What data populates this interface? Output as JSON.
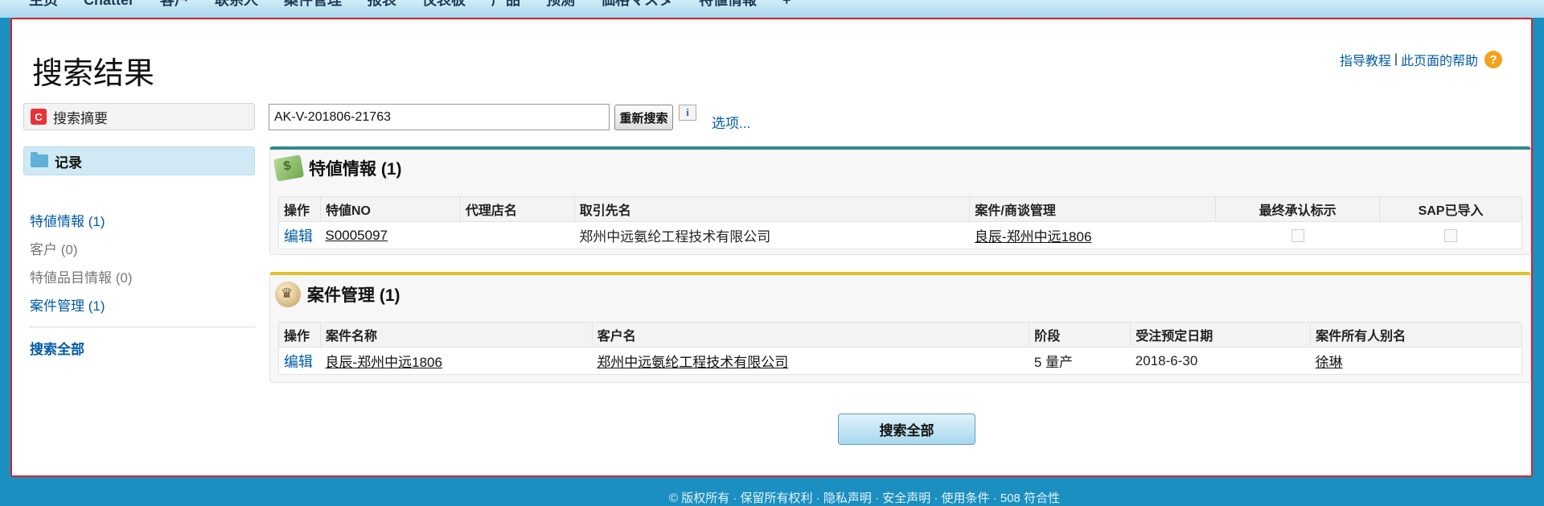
{
  "tabs": [
    "主页",
    "Chatter",
    "客户",
    "联系人",
    "案件管理",
    "报表",
    "仪表板",
    "产品",
    "预测",
    "価格マスタ",
    "特値情報",
    "+"
  ],
  "page": {
    "title": "搜索结果",
    "help_tutorial": "指导教程",
    "help_separator": "|",
    "help_page": "此页面的帮助",
    "help_icon": "?"
  },
  "sidebar": {
    "summary_label": "搜索摘要",
    "summary_icon": "C",
    "records_label": "记录",
    "items": [
      {
        "label": "特値情報",
        "count": "(1)"
      },
      {
        "label": "客户",
        "count": "(0)"
      },
      {
        "label": "特値品目情報",
        "count": "(0)"
      },
      {
        "label": "案件管理",
        "count": "(1)"
      }
    ],
    "search_all": "搜索全部"
  },
  "search": {
    "value": "AK-V-201806-21763",
    "button": "重新搜索",
    "info": "i",
    "options": "选项..."
  },
  "deal_section": {
    "title": "特値情報 (1)",
    "headers": [
      "操作",
      "特値NO",
      "代理店名",
      "取引先名",
      "案件/商谈管理",
      "最终承认标示",
      "SAP已导入"
    ],
    "row": {
      "action": "编辑",
      "no": "S0005097",
      "agent": "",
      "client": "郑州中远氨纶工程技术有限公司",
      "case": "良辰-郑州中远1806"
    }
  },
  "case_section": {
    "title": "案件管理 (1)",
    "headers": [
      "操作",
      "案件名称",
      "客户名",
      "阶段",
      "受注预定日期",
      "案件所有人别名"
    ],
    "row": {
      "action": "编辑",
      "name": "良辰-郑州中远1806",
      "client": "郑州中远氨纶工程技术有限公司",
      "stage": "5 量产",
      "date": "2018-6-30",
      "owner": "徐琳"
    }
  },
  "bottom": {
    "search_all_button": "搜索全部",
    "footer": "© 版权所有 · 保留所有权利 · 隐私声明 · 安全声明 · 使用条件 · 508 符合性"
  },
  "colors": {
    "link": "#015ba7",
    "panel_border": "#d9202e",
    "deal_accent": "#31898f",
    "case_accent": "#e1c02a",
    "background": "#1b8fc0"
  }
}
